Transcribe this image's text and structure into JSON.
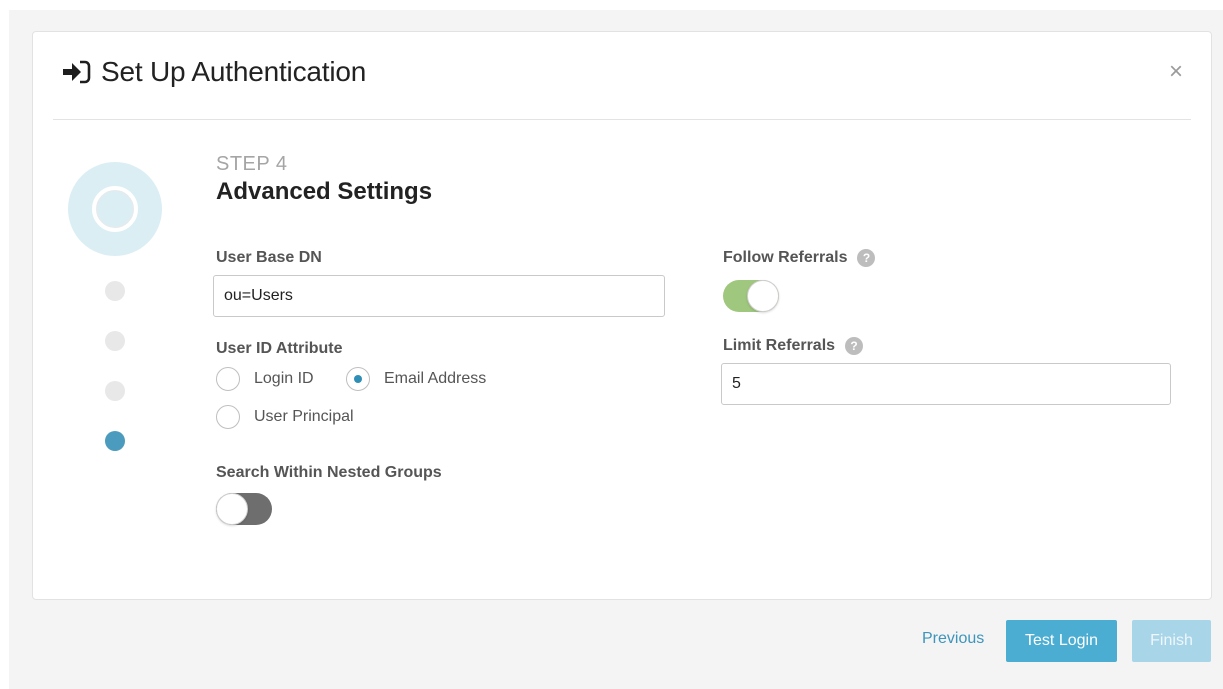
{
  "dialog": {
    "title": "Set Up Authentication",
    "close_glyph": "×",
    "title_icon": "sign-in-icon"
  },
  "stepper": {
    "current_step": 4,
    "total_steps": 4,
    "step_label": "STEP 4",
    "step_title": "Advanced Settings"
  },
  "form": {
    "user_base_dn": {
      "label": "User Base DN",
      "value": "ou=Users"
    },
    "user_id_attribute": {
      "label": "User ID Attribute",
      "options": [
        {
          "label": "Login ID",
          "checked": false
        },
        {
          "label": "Email Address",
          "checked": true
        },
        {
          "label": "User Principal",
          "checked": false
        }
      ]
    },
    "search_nested_groups": {
      "label": "Search Within Nested Groups",
      "enabled": false
    },
    "follow_referrals": {
      "label": "Follow Referrals",
      "enabled": true,
      "help": "?"
    },
    "limit_referrals": {
      "label": "Limit Referrals",
      "value": "5",
      "help": "?"
    }
  },
  "footer": {
    "previous_label": "Previous",
    "test_login_label": "Test Login",
    "finish_label": "Finish"
  },
  "colors": {
    "accent": "#4badd2",
    "link": "#3d95bb",
    "toggle_on": "#9fc77e",
    "toggle_off": "#6e6e6e",
    "active_step": "#4a9bbd"
  }
}
